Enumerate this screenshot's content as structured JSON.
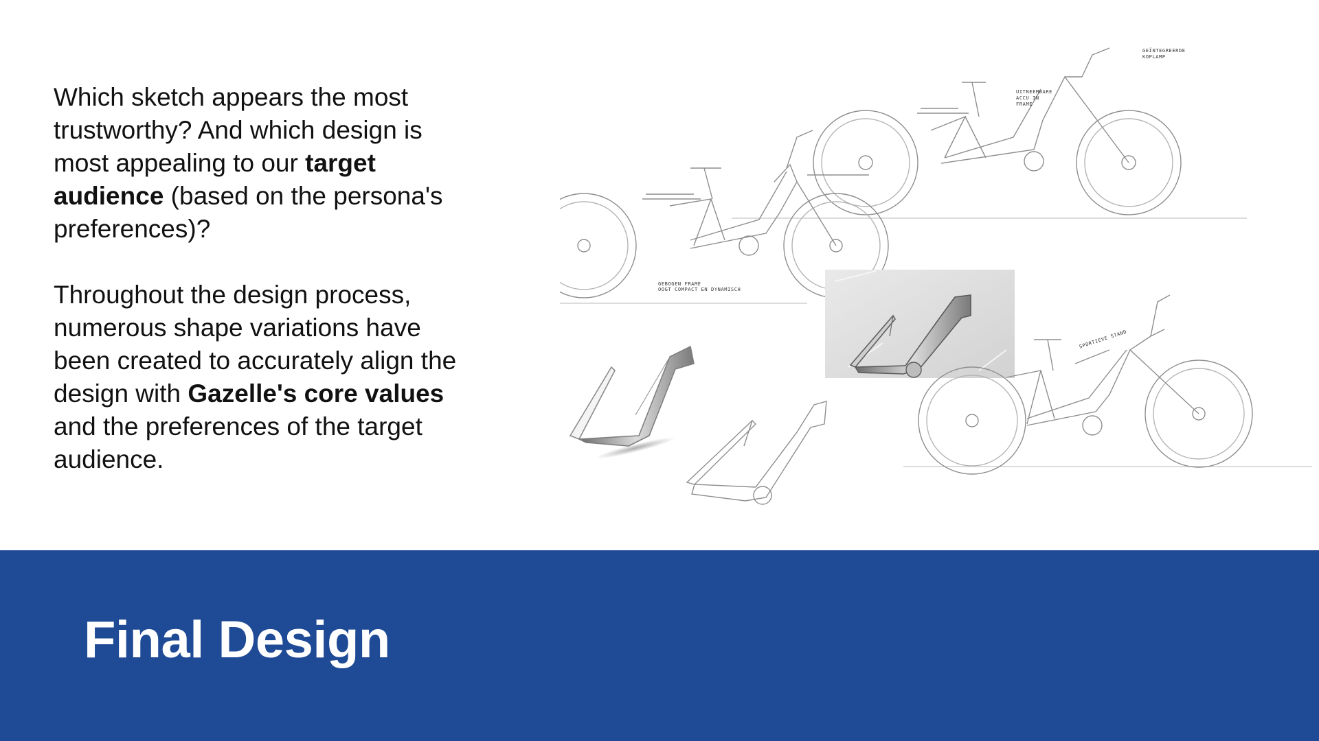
{
  "intro": {
    "p1_a": "Which sketch appears the most trustworthy? And which design is most appealing to our ",
    "p1_bold": "target audience",
    "p1_b": " (based on the persona's preferences)?",
    "p2_a": "Throughout the design process, numerous shape variations have been created to accurately align the design with ",
    "p2_bold": "Gazelle's core values",
    "p2_b": " and the preferences of the target audience."
  },
  "sketches": {
    "label_headlamp": "GEÏNTEGREERDE KOPLAMP",
    "label_battery": "UITNEEMBARE ACCU IN FRAME",
    "label_frame_1": "GEBOGEN FRAME",
    "label_frame_2": "OOGT COMPACT EN DYNAMISCH",
    "label_stance": "SPORTIEVE STAND"
  },
  "footer": {
    "title": "Final Design"
  },
  "colors": {
    "band": "#1f4a95",
    "title_text": "#ffffff",
    "body_text": "#111111",
    "sketch_line": "#9a9a9a"
  }
}
